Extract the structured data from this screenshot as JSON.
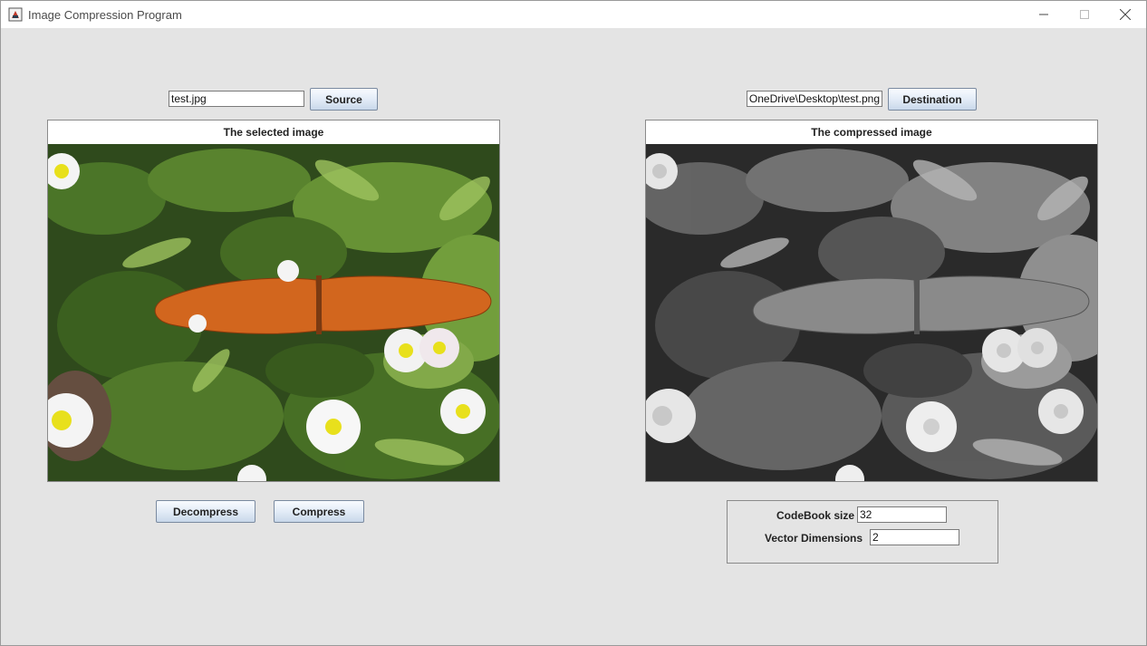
{
  "window": {
    "title": "Image Compression Program",
    "icon": "java-app-icon"
  },
  "source": {
    "path_value": "test.jpg",
    "button_label": "Source"
  },
  "destination": {
    "path_value": "OneDrive\\Desktop\\test.png",
    "button_label": "Destination"
  },
  "panels": {
    "selected_title": "The selected image",
    "compressed_title": "The compressed image"
  },
  "actions": {
    "decompress_label": "Decompress",
    "compress_label": "Compress"
  },
  "params": {
    "codebook_label": "CodeBook size",
    "codebook_value": "32",
    "vector_label": "Vector Dimensions",
    "vector_value": "2"
  },
  "colors": {
    "window_bg": "#e4e4e4",
    "button_gradient_top": "#f8fbff",
    "button_gradient_bottom": "#c9d8ea",
    "butterfly_orange": "#d2661e"
  }
}
